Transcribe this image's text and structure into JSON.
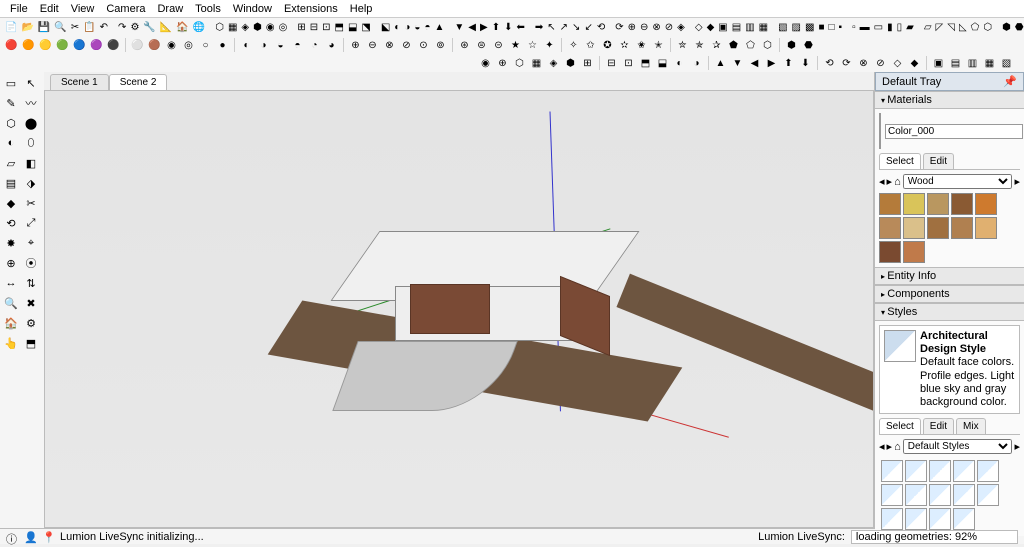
{
  "menu": [
    "File",
    "Edit",
    "View",
    "Camera",
    "Draw",
    "Tools",
    "Window",
    "Extensions",
    "Help"
  ],
  "scene_tabs": [
    "Scene 1",
    "Scene 2"
  ],
  "active_scene": 1,
  "tray": {
    "title": "Default Tray",
    "materials": {
      "title": "Materials",
      "current_name": "Color_000",
      "sub_tabs": [
        "Select",
        "Edit"
      ],
      "library": "Wood",
      "swatches": [
        "#b47b3a",
        "#d9c45a",
        "#b99760",
        "#8a5a33",
        "#ce7a2e",
        "#b88a5a",
        "#dac08a",
        "#a07040",
        "#b08050",
        "#e0b070",
        "#7a4a30",
        "#c07a4a"
      ]
    },
    "panels": [
      "Entity Info",
      "Components",
      "Styles"
    ],
    "styles": {
      "name": "Architectural Design Style",
      "desc": "Default face colors. Profile edges. Light blue sky and gray background color.",
      "sub_tabs": [
        "Select",
        "Edit",
        "Mix"
      ],
      "library": "Default Styles",
      "thumb_count": 14
    }
  },
  "status": {
    "left_message": "Lumion LiveSync initializing...",
    "right_label": "Lumion LiveSync:",
    "right_value": "loading geometries: 92%"
  },
  "left_tool_icons": [
    "▭",
    "↖",
    "✎",
    "〰",
    "⬡",
    "⬤",
    "◐",
    "⬯",
    "▱",
    "◧",
    "▤",
    "⬗",
    "◆",
    "✂",
    "⟲",
    "⤢",
    "✸",
    "⌖",
    "⊕",
    "⦿",
    "↔",
    "⇅",
    "🔍",
    "✖",
    "🏠",
    "⚙",
    "👆",
    "⬒"
  ],
  "toolbar_icons_row1": [
    "📄",
    "📂",
    "💾",
    "🔍",
    "✂",
    "📋",
    "↶",
    "↷",
    "⚙",
    "🔧",
    "📐",
    "🏠",
    "🌐",
    "⬡",
    "▦",
    "◈",
    "⬢",
    "◉",
    "◎",
    "⊞",
    "⊟",
    "⊡",
    "⬒",
    "⬓",
    "⬔",
    "⬕",
    "◐",
    "◑",
    "◒",
    "◓",
    "▲",
    "▼",
    "◀",
    "▶",
    "⬆",
    "⬇",
    "⬅",
    "➡",
    "↖",
    "↗",
    "↘",
    "↙",
    "⟲",
    "⟳",
    "⊕",
    "⊖",
    "⊗",
    "⊘",
    "◈",
    "◇",
    "◆",
    "▣",
    "▤",
    "▥",
    "▦",
    "▧",
    "▨",
    "▩",
    "■",
    "□",
    "▪",
    "▫",
    "▬",
    "▭",
    "▮",
    "▯",
    "▰",
    "▱",
    "◸",
    "◹",
    "◺",
    "⬠",
    "⬡",
    "⬢",
    "⬣"
  ],
  "toolbar_icons_row2": [
    "🔴",
    "🟠",
    "🟡",
    "🟢",
    "🔵",
    "🟣",
    "⚫",
    "⚪",
    "🟤",
    "◉",
    "◎",
    "○",
    "●",
    "◐",
    "◑",
    "◒",
    "◓",
    "◔",
    "◕",
    "⊕",
    "⊖",
    "⊗",
    "⊘",
    "⊙",
    "⊚",
    "⊛",
    "⊜",
    "⊝",
    "★",
    "☆",
    "✦",
    "✧",
    "✩",
    "✪",
    "✫",
    "✬",
    "✭",
    "✮",
    "✯",
    "✰",
    "⬟",
    "⬠",
    "⬡",
    "⬢",
    "⬣"
  ],
  "toolbar_icons_row3": [
    "◉",
    "⊕",
    "⬡",
    "▦",
    "◈",
    "⬢",
    "⊞",
    "⊟",
    "⊡",
    "⬒",
    "⬓",
    "◐",
    "◑",
    "▲",
    "▼",
    "◀",
    "▶",
    "⬆",
    "⬇",
    "⟲",
    "⟳",
    "⊗",
    "⊘",
    "◇",
    "◆",
    "▣",
    "▤",
    "▥",
    "▦",
    "▧"
  ]
}
